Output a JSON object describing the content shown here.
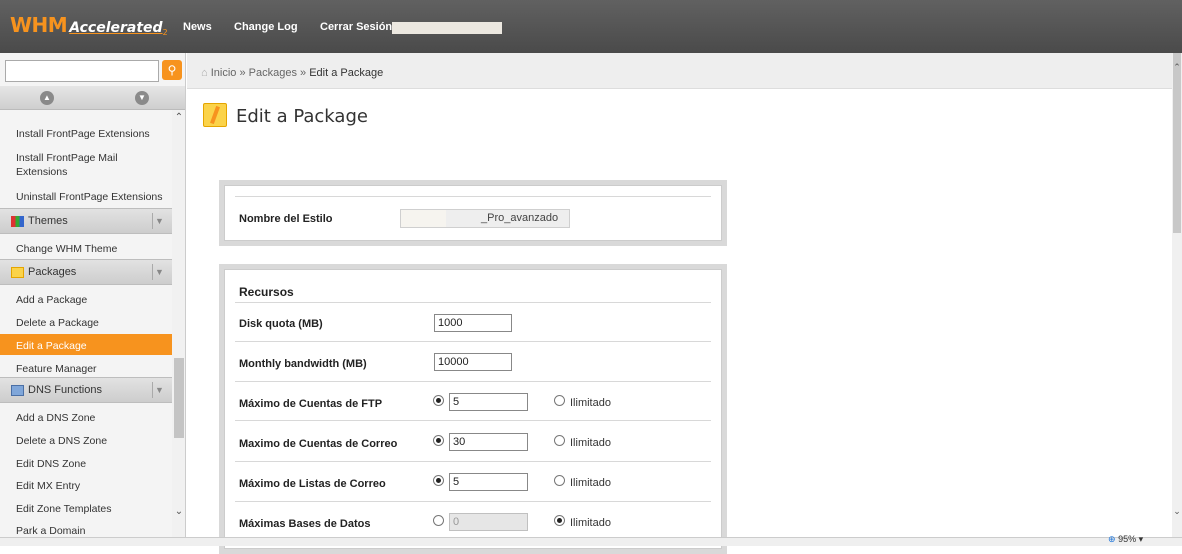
{
  "topbar": {
    "logo_main": "WHM",
    "logo_accelerated": "Accelerated",
    "logo_sub": "2",
    "nav": [
      "News",
      "Change Log",
      "Cerrar Sesión"
    ]
  },
  "sidebar": {
    "search_placeholder": "",
    "items": [
      {
        "type": "item",
        "label": "Install FrontPage Extensions"
      },
      {
        "type": "item",
        "label": "Install FrontPage Mail Extensions"
      },
      {
        "type": "item",
        "label": "Uninstall FrontPage Extensions"
      },
      {
        "type": "category",
        "label": "Themes",
        "icon": "themes-icon"
      },
      {
        "type": "item",
        "label": "Change WHM Theme"
      },
      {
        "type": "category",
        "label": "Packages",
        "icon": "folder-icon"
      },
      {
        "type": "item",
        "label": "Add a Package"
      },
      {
        "type": "item",
        "label": "Delete a Package"
      },
      {
        "type": "item",
        "label": "Edit a Package",
        "active": true
      },
      {
        "type": "item",
        "label": "Feature Manager"
      },
      {
        "type": "category",
        "label": "DNS Functions",
        "icon": "dns-icon"
      },
      {
        "type": "item",
        "label": "Add a DNS Zone"
      },
      {
        "type": "item",
        "label": "Delete a DNS Zone"
      },
      {
        "type": "item",
        "label": "Edit DNS Zone"
      },
      {
        "type": "item",
        "label": "Edit MX Entry"
      },
      {
        "type": "item",
        "label": "Edit Zone Templates"
      },
      {
        "type": "item",
        "label": "Park a Domain"
      }
    ]
  },
  "breadcrumb": {
    "home": "Inicio",
    "sep": "»",
    "packages": "Packages",
    "current": "Edit a Package"
  },
  "page": {
    "title": "Edit a Package"
  },
  "style_panel": {
    "label": "Nombre del Estilo",
    "value": "_Pro_avanzado"
  },
  "resources": {
    "section_title": "Recursos",
    "rows": [
      {
        "label": "Disk quota (MB)",
        "value": "1000",
        "type": "text"
      },
      {
        "label": "Monthly bandwidth (MB)",
        "value": "10000",
        "type": "text"
      },
      {
        "label": "Máximo de Cuentas de FTP",
        "value": "5",
        "type": "radio",
        "limited_checked": true,
        "unlimited_label": "Ilimitado"
      },
      {
        "label": "Maximo de Cuentas de Correo",
        "value": "30",
        "type": "radio",
        "limited_checked": true,
        "unlimited_label": "Ilimitado"
      },
      {
        "label": "Máximo de Listas de Correo",
        "value": "5",
        "type": "radio",
        "limited_checked": true,
        "unlimited_label": "Ilimitado"
      },
      {
        "label": "Máximas Bases de Datos",
        "value": "0",
        "type": "radio",
        "limited_checked": false,
        "unlimited_label": "Ilimitado"
      }
    ]
  },
  "status": {
    "zoom": "95%"
  },
  "colors": {
    "accent": "#f7931e",
    "topbar": "#555555"
  }
}
